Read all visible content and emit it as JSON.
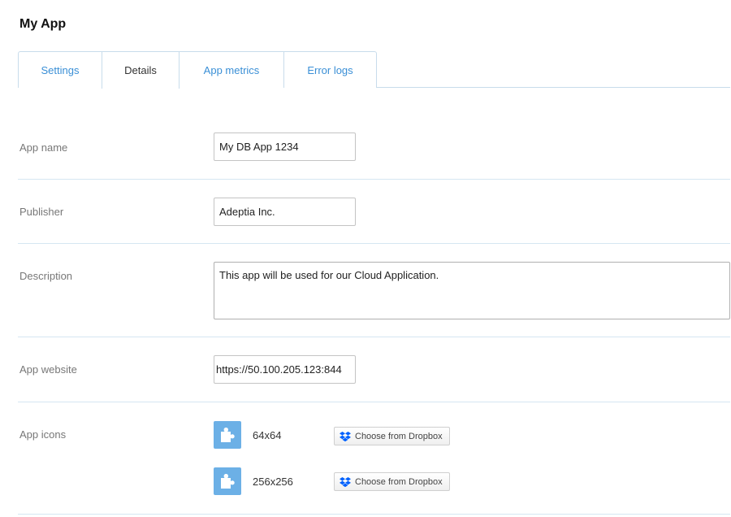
{
  "app": {
    "title": "My App"
  },
  "tabs": [
    {
      "label": "Settings"
    },
    {
      "label": "Details"
    },
    {
      "label": "App metrics"
    },
    {
      "label": "Error logs"
    }
  ],
  "active_tab": "Details",
  "form": {
    "app_name": {
      "label": "App name",
      "value": "My DB App 1234"
    },
    "publisher": {
      "label": "Publisher",
      "value": "Adeptia Inc."
    },
    "description": {
      "label": "Description",
      "value": "This app will be used for our Cloud Application."
    },
    "app_website": {
      "label": "App website",
      "value": "https://50.100.205.123:844"
    },
    "app_icons": {
      "label": "App icons",
      "items": [
        {
          "size": "64x64",
          "button": "Choose from Dropbox"
        },
        {
          "size": "256x256",
          "button": "Choose from Dropbox"
        }
      ]
    }
  },
  "colors": {
    "accent": "#3a8fd6",
    "icon_tile": "#6cb0e6",
    "dropbox": "#0061fe",
    "divider": "#d5e6f2"
  },
  "icons": {
    "app_icon": "puzzle-icon",
    "dropbox": "dropbox-icon"
  }
}
